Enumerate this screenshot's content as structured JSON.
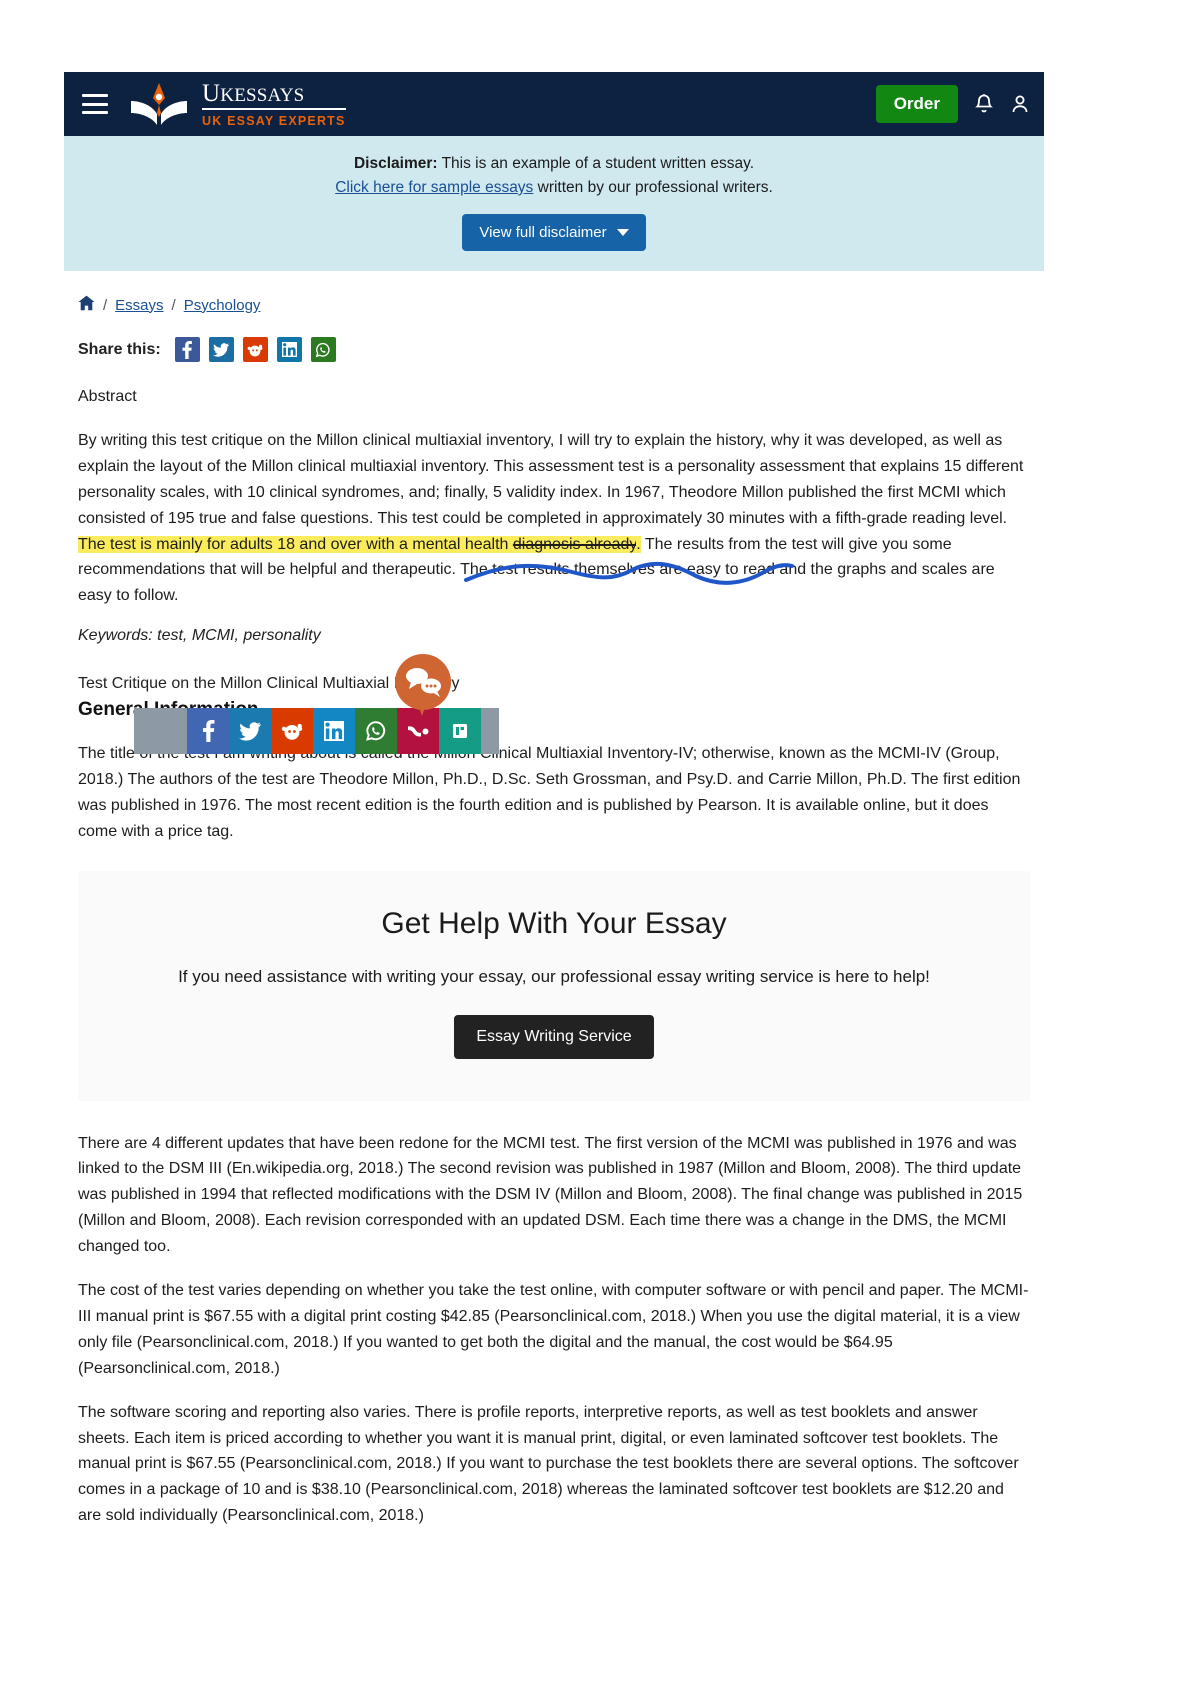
{
  "header": {
    "menu_icon": "hamburger-icon",
    "brand_name": "UKEssays",
    "brand_name_u": "U",
    "brand_name_k_rest": "K",
    "brand_name_rest": "ESSAYS",
    "brand_sub": "UK ESSAY EXPERTS",
    "order_label": "Order",
    "bell_icon": "notification-bell-icon",
    "account_icon": "user-account-icon",
    "bg_color": "#0d2240",
    "order_color": "#128712",
    "accent_color": "#e8620c"
  },
  "disclaimer": {
    "label": "Disclaimer:",
    "text1": " This is an example of a student written essay.",
    "link": "Click here for sample essays",
    "text2": " written by our professional writers.",
    "button": "View full disclaimer",
    "bg_color": "#cfe9ef"
  },
  "breadcrumb": {
    "home_icon": "home-icon",
    "items": [
      "Essays",
      "Psychology"
    ],
    "separator": "/"
  },
  "share": {
    "label": "Share this:",
    "networks": [
      {
        "name": "facebook-share-icon",
        "color": "#3b5998"
      },
      {
        "name": "twitter-share-icon",
        "color": "#1b6ea4"
      },
      {
        "name": "reddit-share-icon",
        "color": "#d93a00"
      },
      {
        "name": "linkedin-share-icon",
        "color": "#0e76a8"
      },
      {
        "name": "whatsapp-share-icon",
        "color": "#2c7a1f"
      }
    ]
  },
  "float_share": {
    "networks": [
      {
        "name": "facebook-share-icon",
        "color": "#4267b2"
      },
      {
        "name": "twitter-share-icon",
        "color": "#1b7bb0"
      },
      {
        "name": "reddit-share-icon",
        "color": "#d93a00"
      },
      {
        "name": "linkedin-share-icon",
        "color": "#1386c4"
      },
      {
        "name": "whatsapp-share-icon",
        "color": "#2e7d32"
      },
      {
        "name": "mix-share-icon",
        "color": "#b3123f"
      },
      {
        "name": "evernote-share-icon",
        "color": "#149c87"
      }
    ],
    "bar_color": "#8e99a6"
  },
  "chat": {
    "icon": "chat-bubble-icon",
    "color": "#cf6532"
  },
  "article": {
    "abstract_label": "Abstract",
    "abstract_before": "By writing this test critique on the Millon clinical multiaxial inventory, I will try to explain the history, why it was developed, as well as explain the layout of the Millon clinical multiaxial inventory. This assessment test is a personality assessment that explains 15 different personality scales, with 10 clinical syndromes, and; finally, 5 validity index. In 1967, Theodore Millon published the first MCMI which consisted of 195 true and false questions. This test could be completed in approximately 30 minutes with a fifth-grade reading level. ",
    "highlight_a": "The test is mainly for adults 18 and over with a mental health ",
    "highlight_b": "diagnosis already",
    "highlight_c": ".",
    "abstract_after": " The results from the test will give you some recommendations that will be helpful and therapeutic. The test results themselves are easy to read and the graphs and scales are easy to follow.",
    "keywords": "Keywords: test, MCMI, personality",
    "essay_title": "Test Critique on the Millon Clinical Multiaxial Inventory",
    "section_title": "General Information",
    "para_general": "The title of the test I am writing about is called the Millon Clinical Multiaxial Inventory-IV; otherwise, known as the MCMI-IV (Group, 2018.) The authors of the test are Theodore Millon, Ph.D., D.Sc. Seth Grossman, and Psy.D. and Carrie Millon, Ph.D. The first edition was published in 1976. The most recent edition is the fourth edition and is published by Pearson. It is available online, but it does come with a price tag.",
    "para_updates": "There are 4 different updates that have been redone for the MCMI test. The first version of the MCMI was published in 1976 and was linked to the DSM III (En.wikipedia.org, 2018.) The second revision was published in 1987 (Millon and Bloom, 2008). The third update was published in 1994 that reflected modifications with the DSM IV (Millon and Bloom, 2008). The final change was published in 2015 (Millon and Bloom, 2008). Each revision corresponded with an updated DSM. Each time there was a change in the DMS, the MCMI changed too.",
    "para_cost": "The cost of the test varies depending on whether you take the test online, with computer software or with pencil and paper. The MCMI-III manual print is $67.55 with a digital print costing $42.85 (Pearsonclinical.com, 2018.) When you use the digital material, it is a view only file (Pearsonclinical.com, 2018.) If you wanted to get both the digital and the manual, the cost would be $64.95 (Pearsonclinical.com, 2018.)",
    "para_software": "The software scoring and reporting also varies. There is profile reports, interpretive reports, as well as test booklets and answer sheets. Each item is priced according to whether you want it is manual print, digital, or even laminated softcover test booklets. The manual print is $67.55 (Pearsonclinical.com, 2018.) If you want to purchase the test booklets there are several options. The softcover comes in a package of 10 and is $38.10 (Pearsonclinical.com, 2018) whereas the laminated softcover test booklets are $12.20 and are sold individually (Pearsonclinical.com, 2018.)"
  },
  "help_cta": {
    "heading": "Get Help With Your Essay",
    "subtext": "If you need assistance with writing your essay, our professional essay writing service is here to help!",
    "button": "Essay Writing Service"
  }
}
